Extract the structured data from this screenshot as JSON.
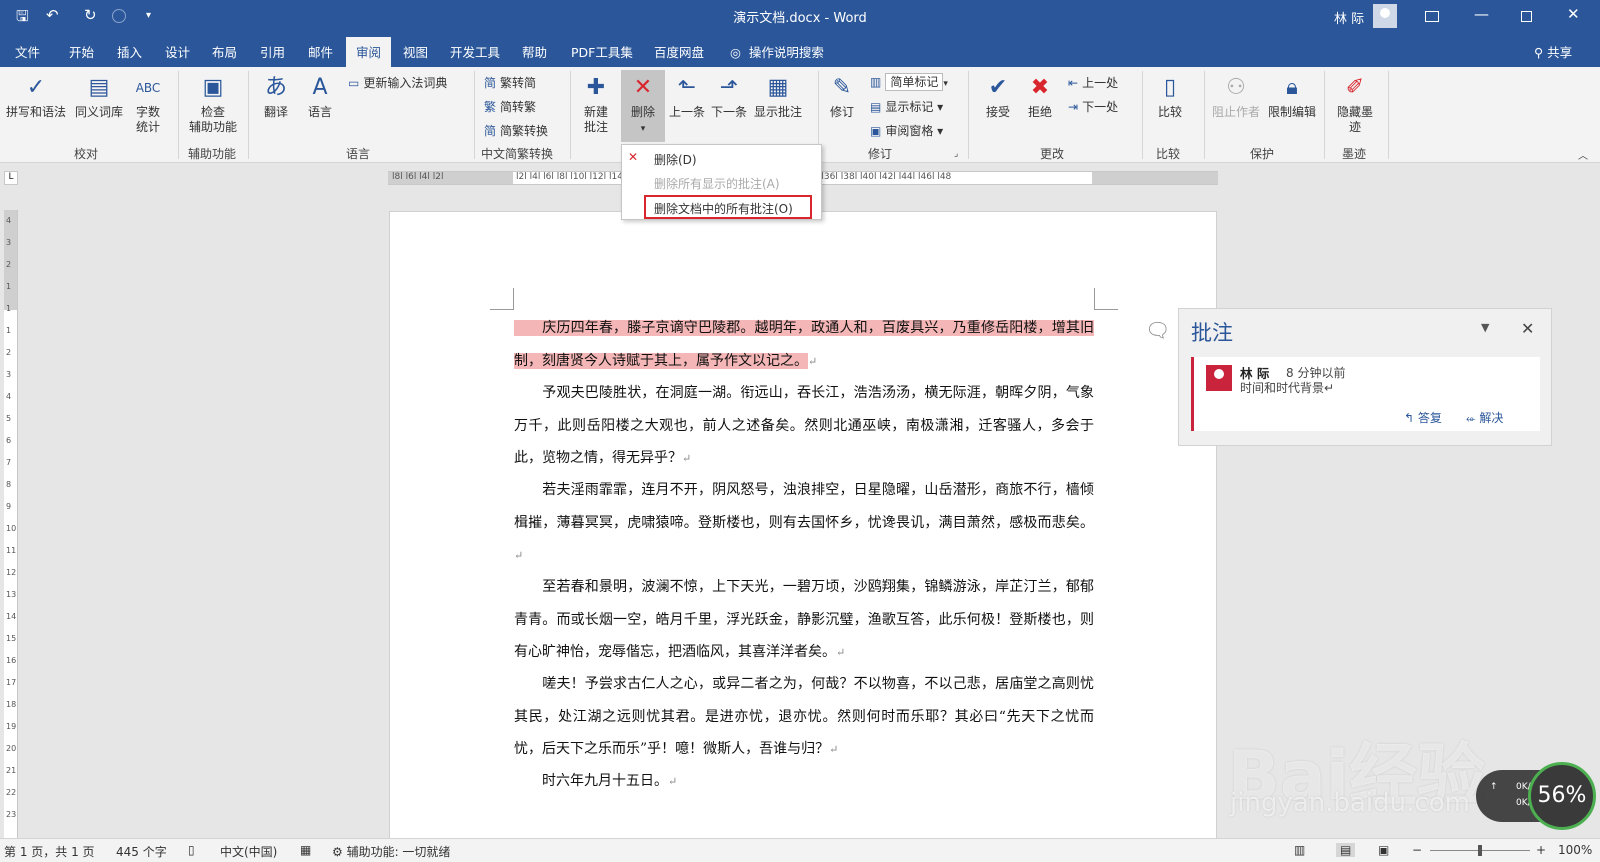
{
  "titlebar": {
    "doc_title": "演示文档.docx  -  Word",
    "user_name": "林 际",
    "qa_save": "🖫",
    "qa_undo": "↶",
    "qa_redo": "↻"
  },
  "tabs": [
    "文件",
    "开始",
    "插入",
    "设计",
    "布局",
    "引用",
    "邮件",
    "审阅",
    "视图",
    "开发工具",
    "帮助",
    "PDF工具集",
    "百度网盘"
  ],
  "active_tab": "审阅",
  "tell_me": "操作说明搜索",
  "share": "共享",
  "ribbon": {
    "spelling": "拼写和语法",
    "thesaurus": "同义词库",
    "wordcount": "字数\n统计",
    "check_access": "检查\n辅助功能",
    "translate": "翻译",
    "language": "语言",
    "update_ime": "更新输入法词典",
    "trad_to_simp": "繁转简",
    "simp_to_trad": "简转繁",
    "convert": "简繁转换",
    "new_comment": "新建\n批注",
    "delete": "删除",
    "prev": "上一条",
    "next": "下一条",
    "show_comments": "显示批注",
    "track": "修订",
    "simple_markup": "简单标记",
    "show_markup": "显示标记",
    "review_pane": "审阅窗格",
    "accept": "接受",
    "reject": "拒绝",
    "prev_change": "上一处",
    "next_change": "下一处",
    "compare": "比较",
    "block_authors": "阻止作者",
    "restrict": "限制编辑",
    "hide_ink": "隐藏墨\n迹",
    "groups": {
      "proofing": "校对",
      "accessibility": "辅助功能",
      "language": "语言",
      "chinese": "中文简繁转换",
      "tracking": "修订",
      "changes": "更改",
      "compare": "比较",
      "protect": "保护",
      "ink": "墨迹"
    }
  },
  "dropdown": {
    "delete": "删除(D)",
    "delete_shown": "删除所有显示的批注(A)",
    "delete_all": "删除文档中的所有批注(O)"
  },
  "ruler": {
    "h_left": "l8l  l6l  l4l  l2l",
    "h_main": "l2l  l4l  l6l  l8l  l10l  l12l  l14l  l16l  l18l  l20l  l22l  l24l  l26l  l28l  l30l  l32l  l34l  l36l  l38l  l40l  l42l  l44l  l46l  l48",
    "v_ticks": [
      "4",
      "3",
      "2",
      "1",
      "1",
      "1",
      "2",
      "3",
      "4",
      "5",
      "6",
      "7",
      "8",
      "9",
      "10",
      "11",
      "12",
      "13",
      "14",
      "15",
      "16",
      "17",
      "18",
      "19",
      "20",
      "21",
      "22",
      "23"
    ]
  },
  "document": {
    "p1_hl": "　　庆历四年春，滕子京谪守巴陵郡。越明年，政通人和，百废具兴，乃重修岳阳楼，增其旧制，刻唐贤今人诗赋于其上，属予作文以记之。",
    "p2": "　　予观夫巴陵胜状，在洞庭一湖。衔远山，吞长江，浩浩汤汤，横无际涯，朝晖夕阴，气象万千，此则岳阳楼之大观也，前人之述备矣。然则北通巫峡，南极潇湘，迁客骚人，多会于此，览物之情，得无异乎？",
    "p3": "　　若夫淫雨霏霏，连月不开，阴风怒号，浊浪排空，日星隐曜，山岳潜形，商旅不行，樯倾楫摧，薄暮冥冥，虎啸猿啼。登斯楼也，则有去国怀乡，忧谗畏讥，满目萧然，感极而悲矣。",
    "p4": "　　至若春和景明，波澜不惊，上下天光，一碧万顷，沙鸥翔集，锦鳞游泳，岸芷汀兰，郁郁青青。而或长烟一空，皓月千里，浮光跃金，静影沉璧，渔歌互答，此乐何极！登斯楼也，则有心旷神怡，宠辱偕忘，把酒临风，其喜洋洋者矣。",
    "p5": "　　嗟夫！予尝求古仁人之心，或异二者之为，何哉？不以物喜，不以己悲，居庙堂之高则忧其民，处江湖之远则忧其君。是进亦忧，退亦忧。然则何时而乐耶？其必曰“先天下之忧而忧，后天下之乐而乐”乎！噫！微斯人，吾谁与归？",
    "p6": "　　时六年九月十五日。",
    "para_mark": "↵"
  },
  "comments": {
    "title": "批注",
    "author": "林 际",
    "time": "8 分钟以前",
    "text": "时间和时代背景↵",
    "reply": "答复",
    "resolve": "解决"
  },
  "watermark": {
    "brand": "Bai经验",
    "url": "jingyan.baidu.com"
  },
  "netwidget": {
    "up": "0K/s",
    "down": "0K/s",
    "percent": "56%"
  },
  "status": {
    "page": "第 1 页，共 1 页",
    "words": "445 个字",
    "lang": "中文(中国)",
    "access": "辅助功能: 一切就绪",
    "zoom": "100%",
    "zoom_level": 0.5
  },
  "colors": {
    "brand": "#2b579a",
    "highlight": "#f4b6b6",
    "comment_accent": "#c9243b",
    "callout": "#d9262e"
  }
}
